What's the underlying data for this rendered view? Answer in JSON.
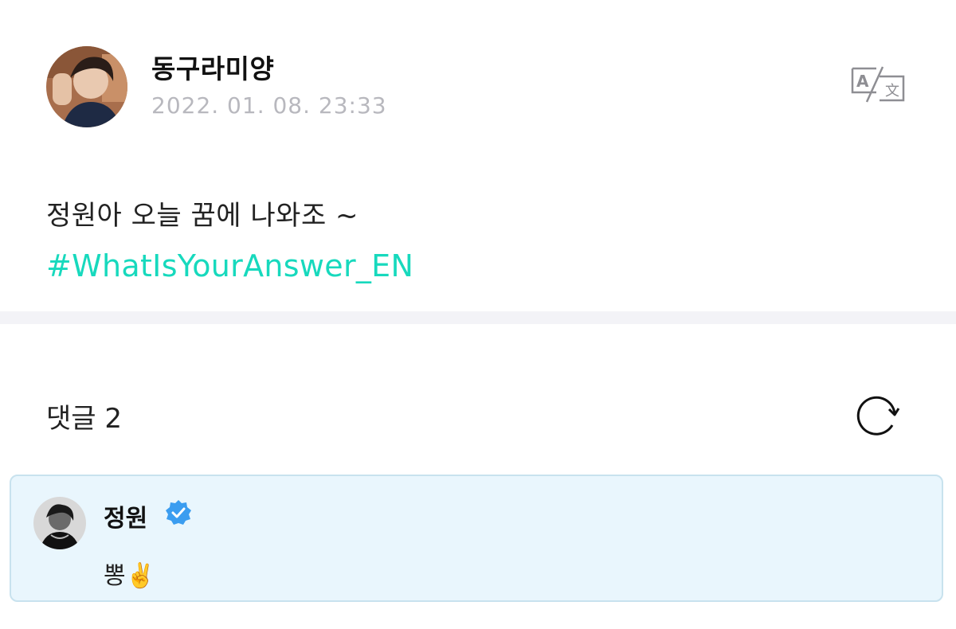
{
  "post": {
    "author": "동구라미양",
    "timestamp": "2022. 01. 08. 23:33",
    "body": "정원아 오늘 꿈에 나와조 ~",
    "hashtag": "#WhatIsYourAnswer_EN",
    "translate_icon": "translate-icon",
    "avatar": "author-avatar"
  },
  "comments": {
    "header": "댓글 2",
    "refresh_icon": "refresh-icon",
    "items": [
      {
        "author": "정원",
        "verified": true,
        "text": "뽕✌️"
      }
    ]
  },
  "colors": {
    "hashtag": "#17d9bd",
    "timestamp": "#b8b8be",
    "comment_bg": "#e9f6fd",
    "comment_border": "#c8e2ee",
    "verified": "#3b9df0",
    "divider": "#f3f3f7"
  }
}
